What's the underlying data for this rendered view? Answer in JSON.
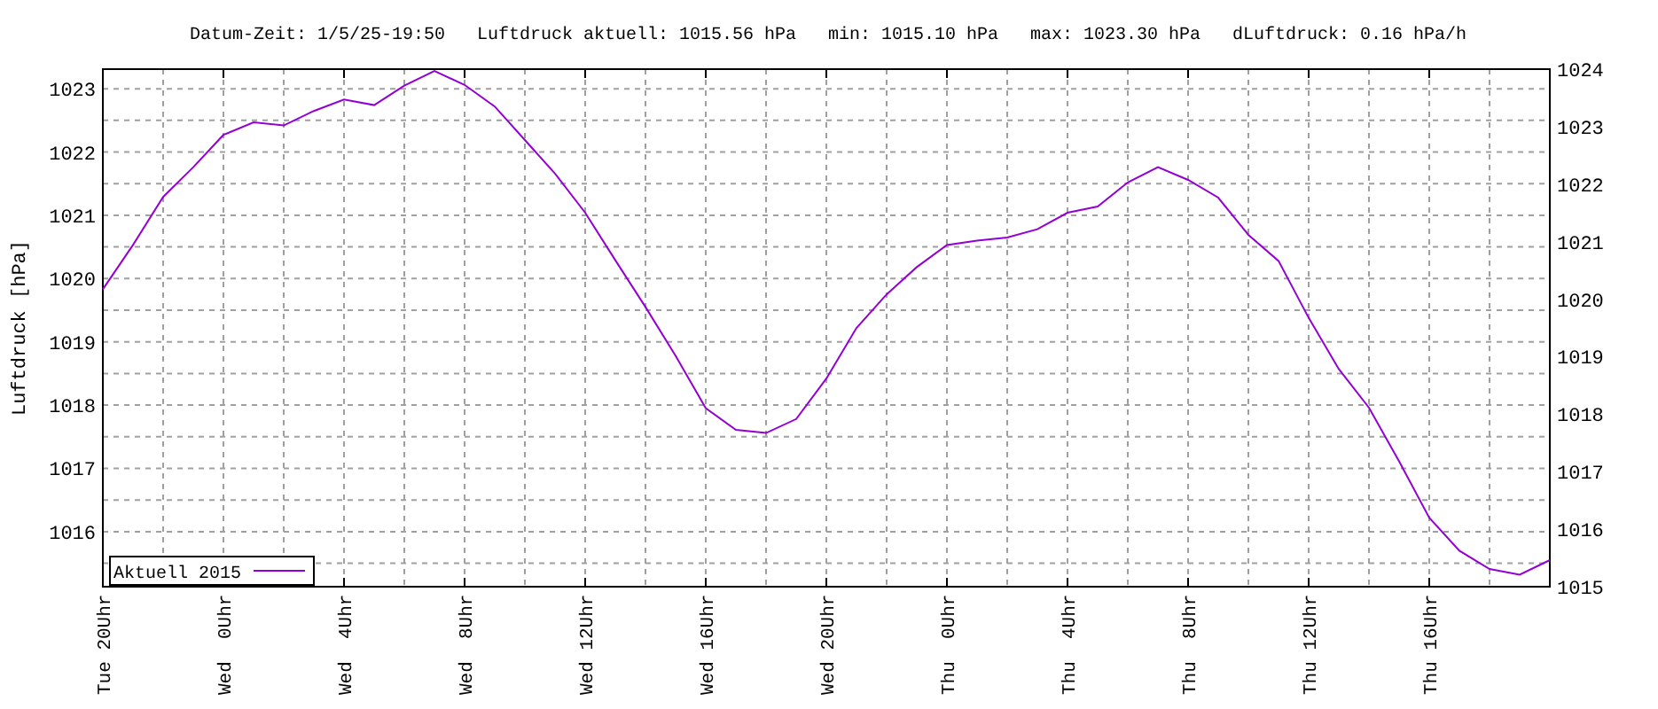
{
  "chart_data": {
    "type": "line",
    "title": "Datum-Zeit: 1/5/25-19:50   Luftdruck aktuell: 1015.56 hPa   min: 1015.10 hPa   max: 1023.30 hPa   dLuftdruck: 0.16 hPa/h",
    "ylabel": "Luftdruck [hPa]",
    "categories": [
      "Tue 20Uhr",
      null,
      null,
      null,
      "Wed  0Uhr",
      null,
      null,
      null,
      "Wed  4Uhr",
      null,
      null,
      null,
      "Wed  8Uhr",
      null,
      null,
      null,
      "Wed 12Uhr",
      null,
      null,
      null,
      "Wed 16Uhr",
      null,
      null,
      null,
      "Wed 20Uhr",
      null,
      null,
      null,
      "Thu  0Uhr",
      null,
      null,
      null,
      "Thu  4Uhr",
      null,
      null,
      null,
      "Thu  8Uhr",
      null,
      null,
      null,
      "Thu 12Uhr",
      null,
      null,
      null,
      "Thu 16Uhr",
      null,
      null,
      null,
      null
    ],
    "series": [
      {
        "name": "Aktuell 2015",
        "color": "#9400d3",
        "values": [
          1019.83,
          1020.53,
          1021.29,
          1021.76,
          1022.27,
          1022.47,
          1022.42,
          1022.65,
          1022.83,
          1022.74,
          1023.05,
          1023.28,
          1023.06,
          1022.72,
          1022.19,
          1021.66,
          1021.04,
          1020.29,
          1019.55,
          1018.78,
          1017.95,
          1017.61,
          1017.56,
          1017.78,
          1018.42,
          1019.22,
          1019.75,
          1020.18,
          1020.53,
          1020.6,
          1020.65,
          1020.78,
          1021.04,
          1021.14,
          1021.52,
          1021.76,
          1021.56,
          1021.28,
          1020.69,
          1020.28,
          1019.38,
          1018.57,
          1017.96,
          1017.11,
          1016.22,
          1015.7,
          1015.41,
          1015.32,
          1015.55
        ]
      }
    ],
    "grid": true,
    "ylim": [
      1015.13,
      1023.31
    ],
    "yticks": [
      1016,
      1017,
      1018,
      1019,
      1020,
      1021,
      1022,
      1023
    ]
  },
  "right_axis": {
    "ticks": [
      "1024",
      "1023",
      "1022",
      "1021",
      "1020",
      "1019",
      "1018",
      "1017",
      "1016",
      "1015"
    ]
  }
}
